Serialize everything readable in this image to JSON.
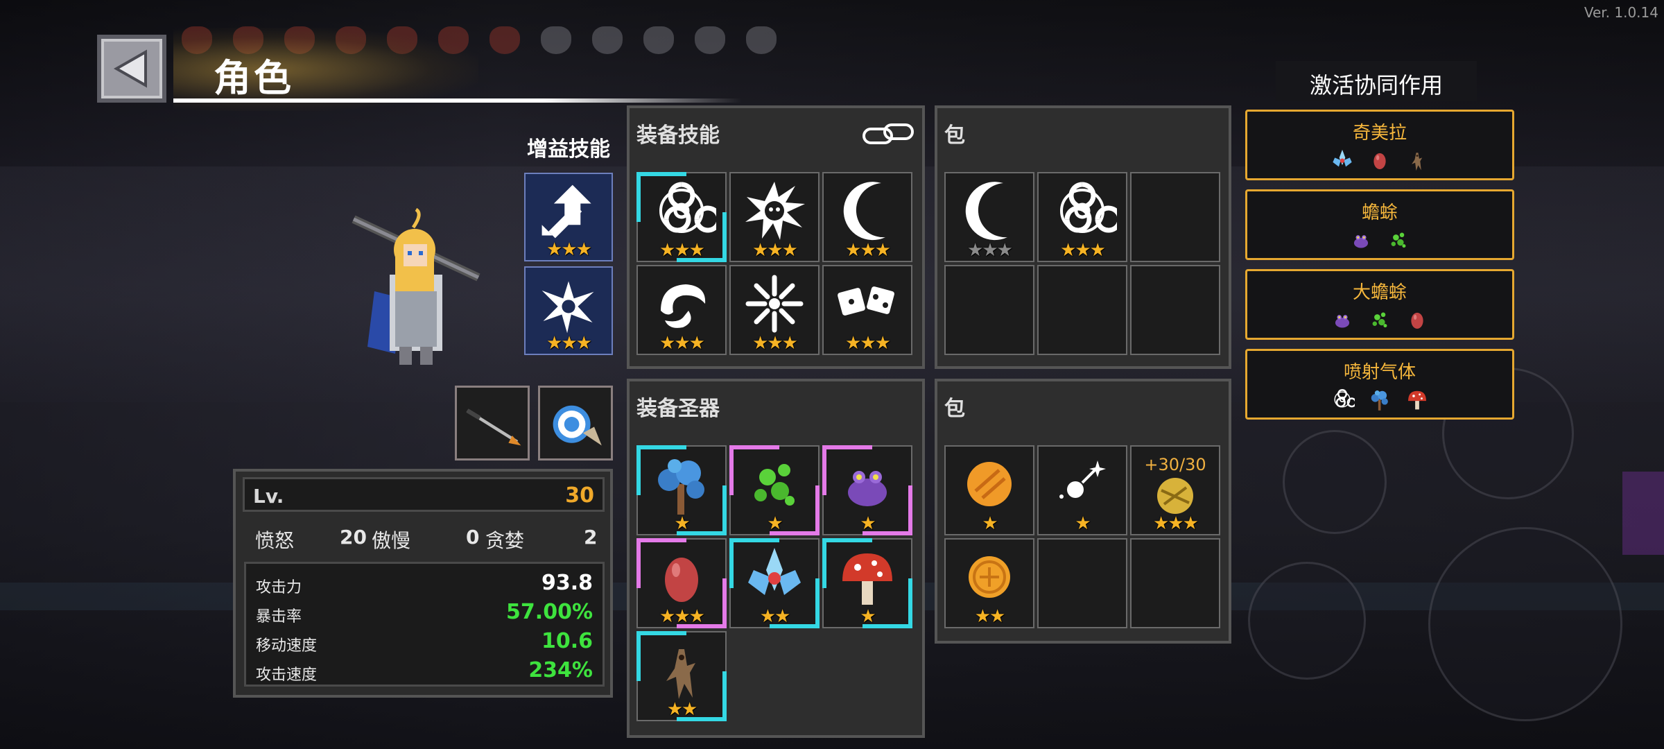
{
  "version": "Ver. 1.0.14",
  "header": {
    "title": "角色"
  },
  "hero": {
    "buff_label": "增益技能",
    "buff_skills": [
      {
        "icon": "power-up-arrow-icon",
        "stars": 3
      },
      {
        "icon": "spiky-burst-icon",
        "stars": 3
      }
    ],
    "gear": [
      {
        "icon": "spear-weapon-icon"
      },
      {
        "icon": "ring-armor-icon"
      }
    ]
  },
  "stats": {
    "level_label": "Lv.",
    "level": "30",
    "traits": [
      {
        "label": "愤怒",
        "value": "20"
      },
      {
        "label": "傲慢",
        "value": "0"
      },
      {
        "label": "贪婪",
        "value": "2"
      }
    ],
    "rows": [
      {
        "label": "攻击力",
        "value": "93.8",
        "color": "#ffffff"
      },
      {
        "label": "暴击率",
        "value": "57.00%",
        "color": "#3ee33e"
      },
      {
        "label": "移动速度",
        "value": "10.6",
        "color": "#3ee33e"
      },
      {
        "label": "攻击速度",
        "value": "234%",
        "color": "#3ee33e"
      }
    ]
  },
  "equipped_skills": {
    "title": "装备技能",
    "link_icon": "chain-link-icon",
    "items": [
      {
        "icon": "biohazard-icon",
        "stars": 3
      },
      {
        "icon": "skull-burst-icon",
        "stars": 3
      },
      {
        "icon": "crescent-slash-icon",
        "stars": 3
      },
      {
        "icon": "whirl-blade-icon",
        "stars": 3
      },
      {
        "icon": "radial-burst-icon",
        "stars": 3
      },
      {
        "icon": "dice-icon",
        "stars": 3
      }
    ]
  },
  "skill_bag": {
    "title": "包",
    "items": [
      {
        "icon": "crescent-slash-icon",
        "stars": 3,
        "dim": true
      },
      {
        "icon": "biohazard-icon",
        "stars": 3
      },
      null,
      null,
      null,
      null
    ]
  },
  "equipped_relics": {
    "title": "装备圣器",
    "items": [
      {
        "icon": "blue-mushroom-icon",
        "stars": 1,
        "frame": "cyan"
      },
      {
        "icon": "green-spores-icon",
        "stars": 1,
        "frame": "pink"
      },
      {
        "icon": "purple-frog-icon",
        "stars": 1,
        "frame": "pink"
      },
      {
        "icon": "red-egg-icon",
        "stars": 3,
        "frame": "pink"
      },
      {
        "icon": "crystal-flower-icon",
        "stars": 2,
        "frame": "cyan"
      },
      {
        "icon": "red-mushroom-icon",
        "stars": 1,
        "frame": "cyan"
      },
      {
        "icon": "root-doll-icon",
        "stars": 2,
        "frame": "cyan"
      }
    ]
  },
  "relic_bag": {
    "title": "包",
    "items": [
      {
        "icon": "orange-orb-icon",
        "stars": 1
      },
      {
        "icon": "sparkle-ball-icon",
        "stars": 1
      },
      {
        "icon": "gold-orb-icon",
        "stars": 3,
        "tag": "+30/30"
      },
      {
        "icon": "gold-coin-icon",
        "stars": 2
      },
      null,
      null
    ]
  },
  "synergy": {
    "title": "激活协同作用",
    "items": [
      {
        "name": "奇美拉",
        "icons": [
          "crystal-flower-icon",
          "red-egg-icon",
          "root-doll-icon"
        ]
      },
      {
        "name": "蟾蜍",
        "icons": [
          "purple-frog-icon",
          "green-spores-icon"
        ]
      },
      {
        "name": "大蟾蜍",
        "icons": [
          "purple-frog-icon",
          "green-spores-icon",
          "red-egg-icon"
        ]
      },
      {
        "name": "喷射气体",
        "icons": [
          "biohazard-icon",
          "blue-mushroom-icon",
          "red-mushroom-icon"
        ]
      }
    ]
  }
}
